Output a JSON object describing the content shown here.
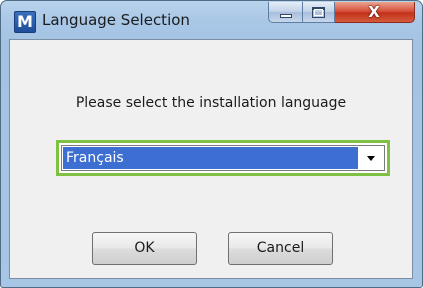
{
  "window": {
    "title": "Language Selection",
    "icon_letter": "M",
    "icon": "app-m-icon",
    "caption_buttons": {
      "minimize": "minimize-icon",
      "maximize": "maximize-icon",
      "close_glyph": "X"
    }
  },
  "dialog": {
    "prompt": "Please select the installation language",
    "language_select": {
      "selected": "Français",
      "arrow": "chevron-down-icon"
    },
    "buttons": {
      "ok_label": "OK",
      "cancel_label": "Cancel"
    }
  },
  "colors": {
    "highlight_border": "#7ec143",
    "selection_background": "#3c6fd1",
    "close_button": "#c2321a"
  }
}
